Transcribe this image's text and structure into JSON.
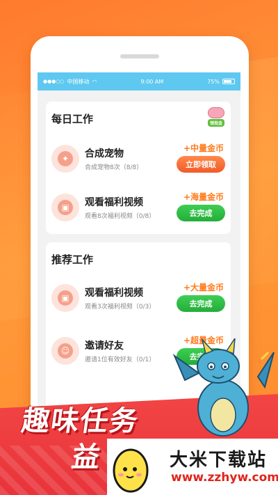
{
  "status_bar": {
    "carrier": "中国移动",
    "time": "9:00 AM",
    "battery": "75%"
  },
  "daily": {
    "title": "每日工作",
    "badge_label": "领现金",
    "tasks": [
      {
        "name": "合成宠物",
        "desc": "合成宠物8次（8/8）",
        "reward": "+中量金币",
        "button": "立即领取",
        "icon": "pet-icon"
      },
      {
        "name": "观看福利视频",
        "desc": "观看8次福利视频（0/8）",
        "reward": "+海量金币",
        "button": "去完成",
        "icon": "gift-icon"
      }
    ]
  },
  "recommended": {
    "title": "推荐工作",
    "tasks": [
      {
        "name": "观看福利视频",
        "desc": "观看3次福利视频（0/3）",
        "reward": "+大量金币",
        "button": "去完成",
        "icon": "gift-icon"
      },
      {
        "name": "邀请好友",
        "desc": "邀请1位有效好友（0/1）",
        "reward": "+超量金币",
        "button": "去完成",
        "icon": "friend-icon"
      }
    ]
  },
  "promo": {
    "line1": "趣味任务",
    "line2": "益"
  },
  "watermark": {
    "title": "大米下载站",
    "url": "www.zzhyw.com"
  },
  "colors": {
    "status_bar": "#5ec8f0",
    "reward": "#ff7a1a",
    "button_claim": "#f25a2a",
    "button_go": "#23ad3a",
    "banner": "#e8343a"
  }
}
